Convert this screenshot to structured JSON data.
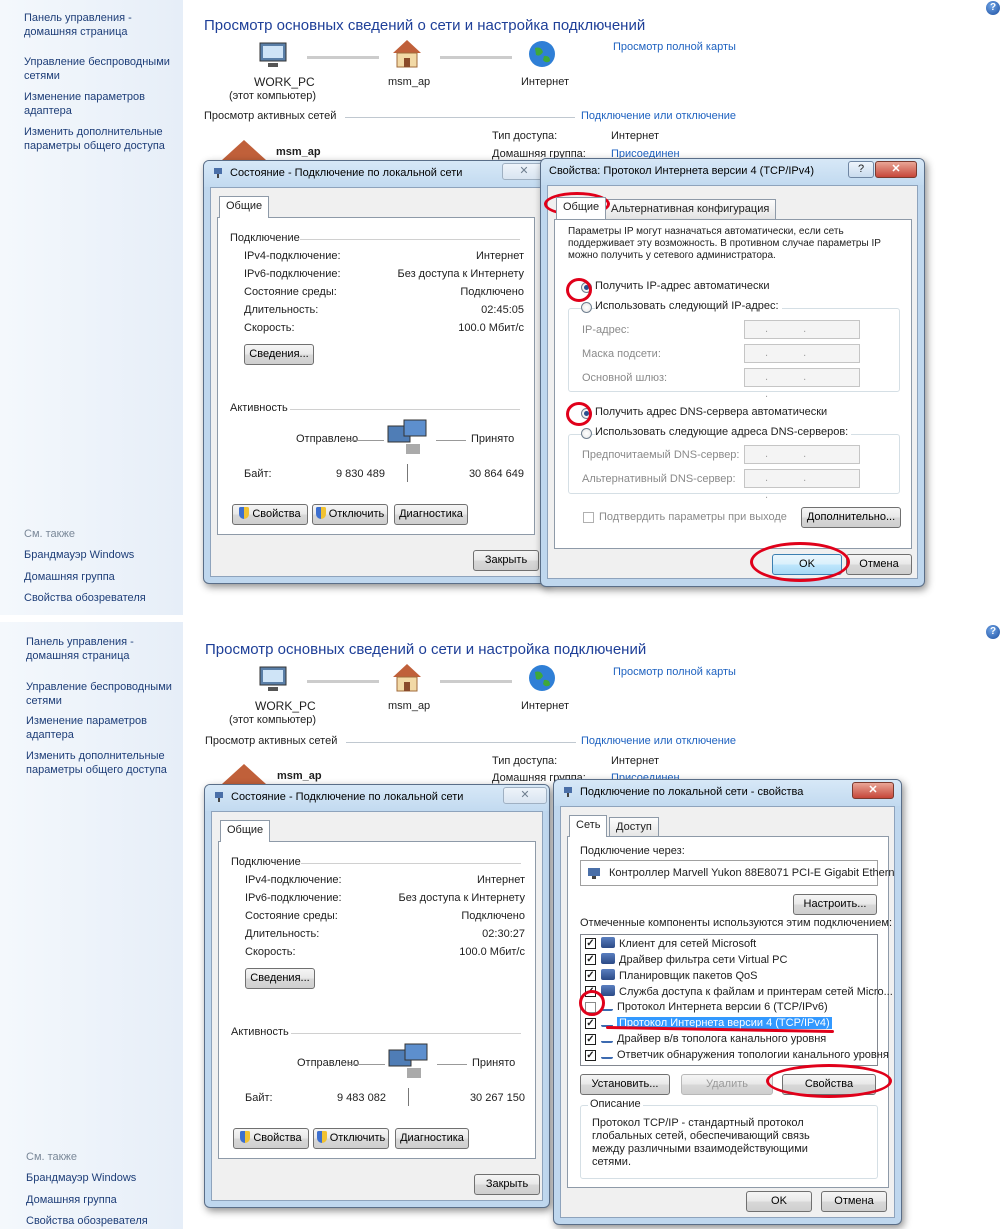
{
  "sidebar": {
    "home": "Панель управления - домашняя страница",
    "wireless": "Управление беспроводными сетями",
    "adapter": "Изменение параметров адаптера",
    "sharing": "Изменить дополнительные параметры общего доступа",
    "see_also": "См. также",
    "firewall": "Брандмауэр Windows",
    "homegroup": "Домашняя группа",
    "browser": "Свойства обозревателя"
  },
  "main": {
    "title": "Просмотр основных сведений о сети и настройка подключений",
    "full_map": "Просмотр полной карты",
    "pc_name": "WORK_PC",
    "pc_sub": "(этот компьютер)",
    "router": "msm_ap",
    "internet": "Интернет",
    "active_networks": "Просмотр активных сетей",
    "connect_disconnect": "Подключение или отключение",
    "network_name": "msm_ap",
    "access_type_label": "Тип доступа:",
    "access_type_value": "Интернет",
    "homegroup_label": "Домашняя группа:",
    "homegroup_value": "Присоединен"
  },
  "status": {
    "title": "Состояние - Подключение по локальной сети",
    "tab": "Общие",
    "connection": "Подключение",
    "ipv4_label": "IPv4-подключение:",
    "ipv4_value": "Интернет",
    "ipv6_label": "IPv6-подключение:",
    "ipv6_value": "Без доступа к Интернету",
    "media_label": "Состояние среды:",
    "media_value": "Подключено",
    "duration_label": "Длительность:",
    "speed_label": "Скорость:",
    "speed_value": "100.0 Мбит/с",
    "details": "Сведения...",
    "activity": "Активность",
    "sent": "Отправлено",
    "received": "Принято",
    "bytes": "Байт:",
    "props": "Свойства",
    "disable": "Отключить",
    "diag": "Диагностика",
    "close": "Закрыть",
    "top": {
      "duration": "02:45:05",
      "sent_bytes": "9 830 489",
      "recv_bytes": "30 864 649"
    },
    "bottom": {
      "duration": "02:30:27",
      "sent_bytes": "9 483 082",
      "recv_bytes": "30 267 150"
    }
  },
  "ipv4": {
    "title": "Свойства: Протокол Интернета версии 4 (TCP/IPv4)",
    "tab_general": "Общие",
    "tab_alt": "Альтернативная конфигурация",
    "desc": "Параметры IP могут назначаться автоматически, если сеть поддерживает эту возможность. В противном случае параметры IP можно получить у сетевого администратора.",
    "auto_ip": "Получить IP-адрес автоматически",
    "manual_ip": "Использовать следующий IP-адрес:",
    "ip_addr": "IP-адрес:",
    "mask": "Маска подсети:",
    "gateway": "Основной шлюз:",
    "auto_dns": "Получить адрес DNS-сервера автоматически",
    "manual_dns": "Использовать следующие адреса DNS-серверов:",
    "pref_dns": "Предпочитаемый DNS-сервер:",
    "alt_dns": "Альтернативный DNS-сервер:",
    "validate": "Подтвердить параметры при выходе",
    "advanced": "Дополнительно...",
    "ok": "OK",
    "cancel": "Отмена",
    "ip_placeholder": ". . ."
  },
  "lanprops": {
    "title": "Подключение по локальной сети - свойства",
    "tab_net": "Сеть",
    "tab_access": "Доступ",
    "connect_using": "Подключение через:",
    "adapter": "Контроллер Marvell Yukon 88E8071 PCI-E Gigabit Ethern",
    "configure": "Настроить...",
    "components_label": "Отмеченные компоненты используются этим подключением:",
    "components": [
      {
        "label": "Клиент для сетей Microsoft",
        "checked": true
      },
      {
        "label": "Драйвер фильтра сети Virtual PC",
        "checked": true
      },
      {
        "label": "Планировщик пакетов QoS",
        "checked": true
      },
      {
        "label": "Служба доступа к файлам и принтерам сетей Micro...",
        "checked": true
      },
      {
        "label": "Протокол Интернета версии 6 (TCP/IPv6)",
        "checked": false
      },
      {
        "label": "Протокол Интернета версии 4 (TCP/IPv4)",
        "checked": true
      },
      {
        "label": "Драйвер в/в тополога канального уровня",
        "checked": true
      },
      {
        "label": "Ответчик обнаружения топологии канального уровня",
        "checked": true
      }
    ],
    "install": "Установить...",
    "uninstall": "Удалить",
    "properties": "Свойства",
    "description_label": "Описание",
    "description": "Протокол TCP/IP - стандартный протокол глобальных сетей, обеспечивающий связь между различными взаимодействующими сетями.",
    "ok": "OK",
    "cancel": "Отмена"
  },
  "colors": {
    "title": "#1e3f98",
    "link": "#1e62c0",
    "highlight": "#e0001a",
    "selection": "#3399ff"
  }
}
